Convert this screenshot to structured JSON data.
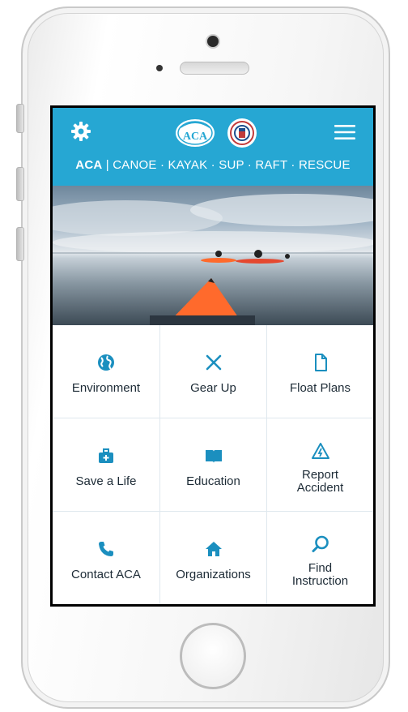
{
  "header": {
    "tagline_strong": "ACA",
    "tagline_rest": " | CANOE · KAYAK · SUP · RAFT · RESCUE",
    "logo_text": "ACA"
  },
  "colors": {
    "header_bg": "#26a7d3",
    "icon": "#1b8fbf",
    "label": "#1d2b36",
    "kayak_orange": "#ff6a2c"
  },
  "tiles": [
    {
      "label": "Environment",
      "icon": "globe-icon"
    },
    {
      "label": "Gear Up",
      "icon": "crossed-tools-icon"
    },
    {
      "label": "Float Plans",
      "icon": "document-icon"
    },
    {
      "label": "Save a Life",
      "icon": "first-aid-kit-icon"
    },
    {
      "label": "Education",
      "icon": "open-book-icon"
    },
    {
      "label": "Report Accident",
      "icon": "warning-icon"
    },
    {
      "label": "Contact ACA",
      "icon": "phone-icon"
    },
    {
      "label": "Organizations",
      "icon": "home-icon"
    },
    {
      "label": "Find Instruction",
      "icon": "search-icon"
    }
  ],
  "tile_lines": {
    "report_1": "Report",
    "report_2": "Accident",
    "find_1": "Find",
    "find_2": "Instruction"
  }
}
